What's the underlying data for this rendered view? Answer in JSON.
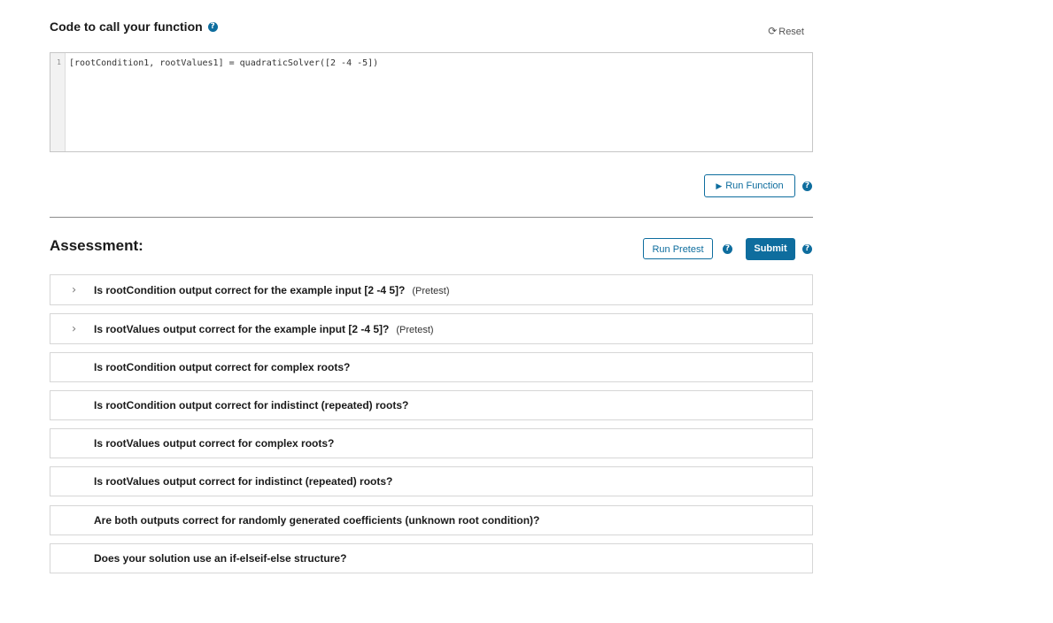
{
  "code_section": {
    "title": "Code to call your function",
    "reset_label": "Reset",
    "editor": {
      "line_number": "1",
      "code": "[rootCondition1, rootValues1] = quadraticSolver([2 -4 -5])"
    },
    "run_function_label": "Run Function"
  },
  "icons": {
    "help": "?",
    "reset": "⟳",
    "play": "▶",
    "chevron": "›"
  },
  "colors": {
    "accent": "#0e6d9e",
    "border": "#d6d6d6"
  },
  "assessment": {
    "title": "Assessment:",
    "run_pretest_label": "Run Pretest",
    "submit_label": "Submit",
    "items": [
      {
        "text": "Is rootCondition output correct for the example input [2 -4 5]?",
        "tag": "(Pretest)"
      },
      {
        "text": "Is rootValues output correct for the example input [2 -4 5]?",
        "tag": "(Pretest)"
      },
      {
        "text": "Is rootCondition output correct for complex roots?"
      },
      {
        "text": "Is rootCondition output correct for indistinct (repeated) roots?"
      },
      {
        "text": "Is rootValues output correct for complex roots?"
      },
      {
        "text": "Is rootValues output correct for indistinct (repeated) roots?"
      },
      {
        "text": "Are both outputs correct for randomly generated coefficients (unknown root condition)?"
      },
      {
        "text": "Does your solution use an if-elseif-else structure?"
      }
    ]
  }
}
